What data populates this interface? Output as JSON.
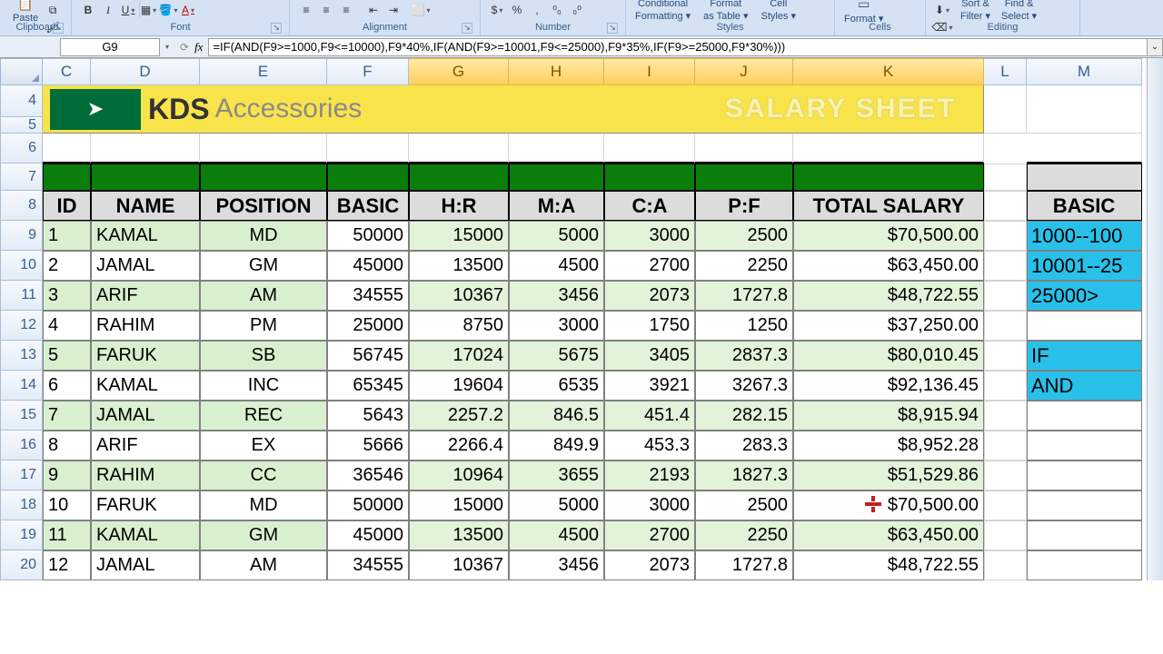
{
  "ribbon": {
    "groups": {
      "clipboard": {
        "label": "Clipboard",
        "paste": "Paste"
      },
      "font": {
        "label": "Font"
      },
      "alignment": {
        "label": "Alignment"
      },
      "number": {
        "label": "Number"
      },
      "styles": {
        "label": "Styles",
        "cond": "Conditional",
        "cond2": "Formatting ▾",
        "table": "Format",
        "table2": "as Table ▾",
        "cell": "Cell",
        "cell2": "Styles ▾"
      },
      "cells": {
        "label": "Cells",
        "format": "Format ▾"
      },
      "editing": {
        "label": "Editing",
        "sort": "Sort &",
        "sort2": "Filter ▾",
        "find": "Find &",
        "find2": "Select ▾"
      }
    }
  },
  "name_box": "G9",
  "formula": "=IF(AND(F9>=1000,F9<=10000),F9*40%,IF(AND(F9>=10001,F9<=25000),F9*35%,IF(F9>=25000,F9*30%)))",
  "banner": {
    "brand": "KDS",
    "sub": "Accessories",
    "title": "SALARY SHEET"
  },
  "columns": [
    "C",
    "D",
    "E",
    "F",
    "G",
    "H",
    "I",
    "J",
    "K",
    "L",
    "M"
  ],
  "headers": {
    "C": "ID",
    "D": "NAME",
    "E": "POSITION",
    "F": "BASIC",
    "G": "H:R",
    "H": "M:A",
    "I": "C:A",
    "J": "P:F",
    "K": "TOTAL SALARY"
  },
  "rows": [
    {
      "n": 9,
      "id": "1",
      "name": "KAMAL",
      "pos": "MD",
      "basic": "50000",
      "hr": "15000",
      "ma": "5000",
      "ca": "3000",
      "pf": "2500",
      "total": "$70,500.00"
    },
    {
      "n": 10,
      "id": "2",
      "name": "JAMAL",
      "pos": "GM",
      "basic": "45000",
      "hr": "13500",
      "ma": "4500",
      "ca": "2700",
      "pf": "2250",
      "total": "$63,450.00"
    },
    {
      "n": 11,
      "id": "3",
      "name": "ARIF",
      "pos": "AM",
      "basic": "34555",
      "hr": "10367",
      "ma": "3456",
      "ca": "2073",
      "pf": "1727.8",
      "total": "$48,722.55"
    },
    {
      "n": 12,
      "id": "4",
      "name": "RAHIM",
      "pos": "PM",
      "basic": "25000",
      "hr": "8750",
      "ma": "3000",
      "ca": "1750",
      "pf": "1250",
      "total": "$37,250.00"
    },
    {
      "n": 13,
      "id": "5",
      "name": "FARUK",
      "pos": "SB",
      "basic": "56745",
      "hr": "17024",
      "ma": "5675",
      "ca": "3405",
      "pf": "2837.3",
      "total": "$80,010.45"
    },
    {
      "n": 14,
      "id": "6",
      "name": "KAMAL",
      "pos": "INC",
      "basic": "65345",
      "hr": "19604",
      "ma": "6535",
      "ca": "3921",
      "pf": "3267.3",
      "total": "$92,136.45"
    },
    {
      "n": 15,
      "id": "7",
      "name": "JAMAL",
      "pos": "REC",
      "basic": "5643",
      "hr": "2257.2",
      "ma": "846.5",
      "ca": "451.4",
      "pf": "282.15",
      "total": "$8,915.94"
    },
    {
      "n": 16,
      "id": "8",
      "name": "ARIF",
      "pos": "EX",
      "basic": "5666",
      "hr": "2266.4",
      "ma": "849.9",
      "ca": "453.3",
      "pf": "283.3",
      "total": "$8,952.28"
    },
    {
      "n": 17,
      "id": "9",
      "name": "RAHIM",
      "pos": "CC",
      "basic": "36546",
      "hr": "10964",
      "ma": "3655",
      "ca": "2193",
      "pf": "1827.3",
      "total": "$51,529.86"
    },
    {
      "n": 18,
      "id": "10",
      "name": "FARUK",
      "pos": "MD",
      "basic": "50000",
      "hr": "15000",
      "ma": "5000",
      "ca": "3000",
      "pf": "2500",
      "total": "$70,500.00"
    },
    {
      "n": 19,
      "id": "11",
      "name": "KAMAL",
      "pos": "GM",
      "basic": "45000",
      "hr": "13500",
      "ma": "4500",
      "ca": "2700",
      "pf": "2250",
      "total": "$63,450.00"
    },
    {
      "n": 20,
      "id": "12",
      "name": "JAMAL",
      "pos": "AM",
      "basic": "34555",
      "hr": "10367",
      "ma": "3456",
      "ca": "2073",
      "pf": "1727.8",
      "total": "$48,722.55"
    }
  ],
  "side": {
    "basic": "BASIC",
    "r1": "1000--100",
    "r2": "10001--25",
    "r3": "25000>",
    "if": "IF",
    "and": "AND"
  }
}
